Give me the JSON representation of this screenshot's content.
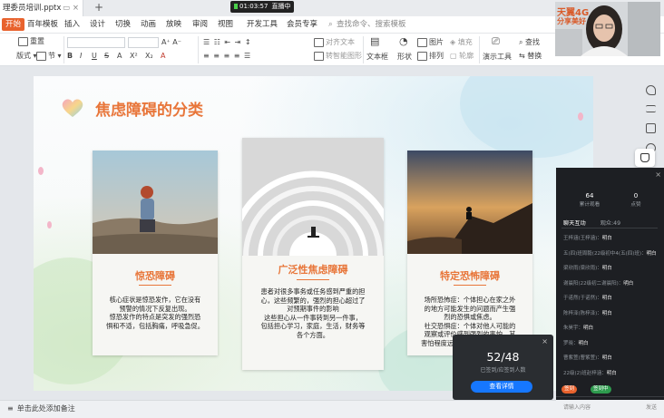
{
  "tab": {
    "title": "理委员培训.pptx"
  },
  "recording": {
    "time": "01:03:57",
    "status": "直播中"
  },
  "brand": {
    "line1": "天翼4G",
    "line2": "分享美好"
  },
  "menu": {
    "start": "开始",
    "items": [
      "百年模板",
      "插入",
      "设计",
      "切换",
      "动画",
      "放映",
      "审阅",
      "视图",
      "开发工具",
      "会员专享"
    ],
    "search": "查找命令、搜索模板"
  },
  "toolbar": {
    "reset": "重置",
    "layout": "版式",
    "section": "节",
    "font_buttons": [
      "B",
      "I",
      "U",
      "S",
      "A",
      "X²",
      "X₂",
      "A"
    ],
    "align_text": "对齐文本",
    "smartart": "转智能图形",
    "textbox": "文本框",
    "shape": "形状",
    "picture": "图片",
    "fill": "填充",
    "arrange": "排列",
    "outline": "轮廓",
    "presenter": "演示工具",
    "find": "查找",
    "replace": "替换",
    "select": "选择",
    "single": "单机"
  },
  "slide": {
    "title": "焦虑障碍的分类",
    "cards": [
      {
        "title": "惊恐障碍",
        "text": "核心症状是惊恐发作，它在没有\n预警的情况下反复出现。\n惊恐发作的特点是突发的强烈恐\n惧和不适，包括胸痛，呼吸急促。"
      },
      {
        "title": "广泛性焦虑障碍",
        "text": "患者对很多事务或任务感到严重的担\n心，这些频繁的，强烈的担心超过了\n对预期事件的影响\n这些担心从一件事转到另一件事，\n包括担心学习，家庭，生活，财务等\n各个方面。"
      },
      {
        "title": "特定恐怖障碍",
        "text": "场所恐怖症：个体担心在家之外\n的地方可能发生的问题而产生强\n烈的恐惧或焦虑。\n社交恐惧症：个体对他人可能的\n观察或评价感到强烈的害怕，其\n害怕程度远远超过了实际的风险。"
      }
    ]
  },
  "live_panel": {
    "online_count": "64",
    "online_label": "累计观看",
    "like_count": "0",
    "like_label": "点赞",
    "tabs": [
      "聊天互动",
      "观众:49"
    ],
    "messages": [
      {
        "name": "王梓涵(王梓涵)：",
        "text": "明白"
      },
      {
        "name": "五(四)班周毅(22级初中4(五(四)班)：",
        "text": "明白"
      },
      {
        "name": "梁欣雨(梁欣雨)：",
        "text": "明白"
      },
      {
        "name": "谢晨阳(22级初二谢晨阳)：",
        "text": "明白"
      },
      {
        "name": "于诺然(于诺然)：",
        "text": "明白"
      },
      {
        "name": "陈梓泽(陈梓泽)：",
        "text": "明白"
      },
      {
        "name": "朱昊宇：",
        "text": "明白"
      },
      {
        "name": "罗晓：",
        "text": "明白"
      },
      {
        "name": "曹紫萱(曹紫萱)：",
        "text": "明白"
      },
      {
        "name": "22级(2)班赵梓涵：",
        "text": "明白"
      }
    ],
    "sign_button": "签到",
    "sign_done": "签到中",
    "input_placeholder": "请输入内容",
    "send": "发送"
  },
  "popup": {
    "count": "52/48",
    "subtitle": "已签到/应签到人数",
    "button": "查看详情"
  },
  "notes": {
    "placeholder": "单击此处添加备注"
  }
}
